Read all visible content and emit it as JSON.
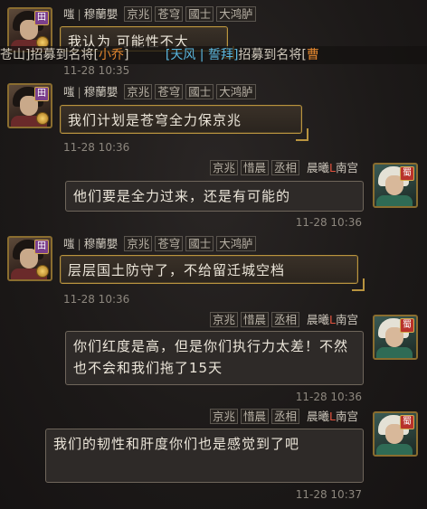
{
  "messages": [
    {
      "side": "left",
      "sender": {
        "name": "嗤",
        "guild": "穆蘭嬰",
        "tags": [
          "京兆",
          "苍穹",
          "國士",
          "大鸿胪"
        ]
      },
      "badge": "田",
      "text": "我认为 可能性不大",
      "timestamp": "11-28 10:35"
    },
    {
      "side": "left",
      "sender": {
        "name": "嗤",
        "guild": "穆蘭嬰",
        "tags": [
          "京兆",
          "苍穹",
          "國士",
          "大鸿胪"
        ]
      },
      "badge": "田",
      "text": "我们计划是苍穹全力保京兆",
      "timestamp": "11-28 10:36"
    },
    {
      "side": "right",
      "sender": {
        "tags": [
          "京兆",
          "惜晨",
          "丞相"
        ],
        "name_prefix": "晨曦",
        "name_red": "L",
        "name_suffix": "南宫"
      },
      "badge": "蜀",
      "text": "他们要是全力过来，还是有可能的",
      "timestamp": "11-28 10:36"
    },
    {
      "side": "left",
      "sender": {
        "name": "嗤",
        "guild": "穆蘭嬰",
        "tags": [
          "京兆",
          "苍穹",
          "國士",
          "大鸿胪"
        ]
      },
      "badge": "田",
      "text": "层层国土防守了，不给留迁城空档",
      "timestamp": "11-28 10:36"
    },
    {
      "side": "right",
      "sender": {
        "tags": [
          "京兆",
          "惜晨",
          "丞相"
        ],
        "name_prefix": "晨曦",
        "name_red": "L",
        "name_suffix": "南宫"
      },
      "badge": "蜀",
      "text": "你们红度是高，但是你们执行力太差！不然也不会和我们拖了15天",
      "timestamp": "11-28 10:36"
    },
    {
      "side": "right",
      "sender": {
        "tags": [
          "京兆",
          "惜晨",
          "丞相"
        ],
        "name_prefix": "晨曦",
        "name_red": "L",
        "name_suffix": "南宫"
      },
      "badge": "蜀",
      "text": "我们的韧性和肝度你们也是感觉到了吧",
      "timestamp": "11-28 10:37"
    }
  ],
  "system_line": {
    "part1": "苍山]招募到名将[",
    "general1": "小乔",
    "part2": "]",
    "player2": "[天风 | 誓拜]",
    "part3": "招募到名将[",
    "general2": "曹"
  }
}
